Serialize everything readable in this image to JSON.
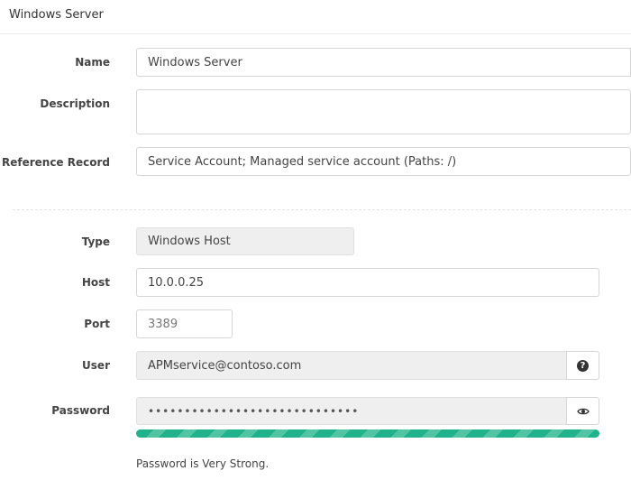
{
  "header": {
    "title": "Windows Server"
  },
  "form": {
    "name": {
      "label": "Name",
      "value": "Windows Server"
    },
    "description": {
      "label": "Description",
      "value": ""
    },
    "reference": {
      "label": "Reference Record",
      "value": "Service Account; Managed service account (Paths: /)"
    },
    "type": {
      "label": "Type",
      "value": "Windows Host"
    },
    "host": {
      "label": "Host",
      "value": "10.0.0.25"
    },
    "port": {
      "label": "Port",
      "value": "3389"
    },
    "user": {
      "label": "User",
      "value": "APMservice@contoso.com",
      "help_icon": "question-circle-icon"
    },
    "password": {
      "label": "Password",
      "masked_value": "•••••••••••••••••••••••••••••",
      "reveal_icon": "eye-icon",
      "strength_fraction": 1.0,
      "strength_text": "Password is Very Strong.",
      "strength_color": "#20b38b"
    }
  }
}
